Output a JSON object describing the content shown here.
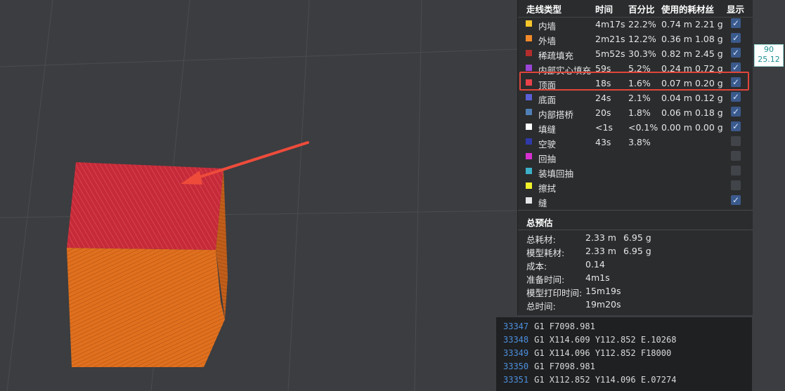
{
  "legend": {
    "headers": {
      "type": "走线类型",
      "time": "时间",
      "percent": "百分比",
      "filament": "使用的耗材丝",
      "show": "显示"
    },
    "rows": [
      {
        "name": "内墙",
        "time": "4m17s",
        "percent": "22.2%",
        "length": "0.74 m",
        "weight": "2.21 g",
        "color": "#f5c62b",
        "show": true
      },
      {
        "name": "外墙",
        "time": "2m21s",
        "percent": "12.2%",
        "length": "0.36 m",
        "weight": "1.08 g",
        "color": "#f28a2a",
        "show": true
      },
      {
        "name": "稀疏填充",
        "time": "5m52s",
        "percent": "30.3%",
        "length": "0.82 m",
        "weight": "2.45 g",
        "color": "#b32d2d",
        "show": true
      },
      {
        "name": "内部实心填充",
        "time": "59s",
        "percent": "5.2%",
        "length": "0.24 m",
        "weight": "0.72 g",
        "color": "#9a45d6",
        "show": true
      },
      {
        "name": "顶面",
        "time": "18s",
        "percent": "1.6%",
        "length": "0.07 m",
        "weight": "0.20 g",
        "color": "#e8424a",
        "show": true
      },
      {
        "name": "底面",
        "time": "24s",
        "percent": "2.1%",
        "length": "0.04 m",
        "weight": "0.12 g",
        "color": "#5a5fd6",
        "show": true
      },
      {
        "name": "内部搭桥",
        "time": "20s",
        "percent": "1.8%",
        "length": "0.06 m",
        "weight": "0.18 g",
        "color": "#4f7fb5",
        "show": true
      },
      {
        "name": "填缝",
        "time": "<1s",
        "percent": "<0.1%",
        "length": "0.00 m",
        "weight": "0.00 g",
        "color": "#ffffff",
        "show": true
      },
      {
        "name": "空驶",
        "time": "43s",
        "percent": "3.8%",
        "length": "",
        "weight": "",
        "color": "#2f3aa8",
        "show": false
      },
      {
        "name": "回抽",
        "time": "",
        "percent": "",
        "length": "",
        "weight": "",
        "color": "#d630d0",
        "show": false
      },
      {
        "name": "装填回抽",
        "time": "",
        "percent": "",
        "length": "",
        "weight": "",
        "color": "#3cb1c9",
        "show": false
      },
      {
        "name": "擦拭",
        "time": "",
        "percent": "",
        "length": "",
        "weight": "",
        "color": "#f2f22a",
        "show": false
      },
      {
        "name": "缝",
        "time": "",
        "percent": "",
        "length": "",
        "weight": "",
        "color": "#e6e6e6",
        "show": true
      }
    ]
  },
  "summary": {
    "title": "总预估",
    "rows": [
      {
        "label": "总耗材:",
        "v1": "2.33 m",
        "v2": "6.95 g"
      },
      {
        "label": "模型耗材:",
        "v1": "2.33 m",
        "v2": "6.95 g"
      },
      {
        "label": "成本:",
        "v1": "0.14",
        "v2": ""
      },
      {
        "label": "准备时间:",
        "v1": "4m1s",
        "v2": ""
      },
      {
        "label": "模型打印时间:",
        "v1": "15m19s",
        "v2": ""
      },
      {
        "label": "总时间:",
        "v1": "19m20s",
        "v2": ""
      }
    ]
  },
  "side_label": {
    "top": "90",
    "bottom": "25.12"
  },
  "gcode": [
    {
      "num": "33347",
      "text": "G1 F7098.981"
    },
    {
      "num": "33348",
      "text": "G1 X114.609 Y112.852 E.10268"
    },
    {
      "num": "33349",
      "text": "G1 X114.096 Y112.852 F18000"
    },
    {
      "num": "33350",
      "text": "G1 F7098.981"
    },
    {
      "num": "33351",
      "text": "G1 X112.852 Y114.096 E.07274"
    }
  ],
  "colors": {
    "highlight": "#e0463a",
    "top_surface": "#c62a38",
    "walls": "#e0701e",
    "accent": "#4b8fdc"
  }
}
